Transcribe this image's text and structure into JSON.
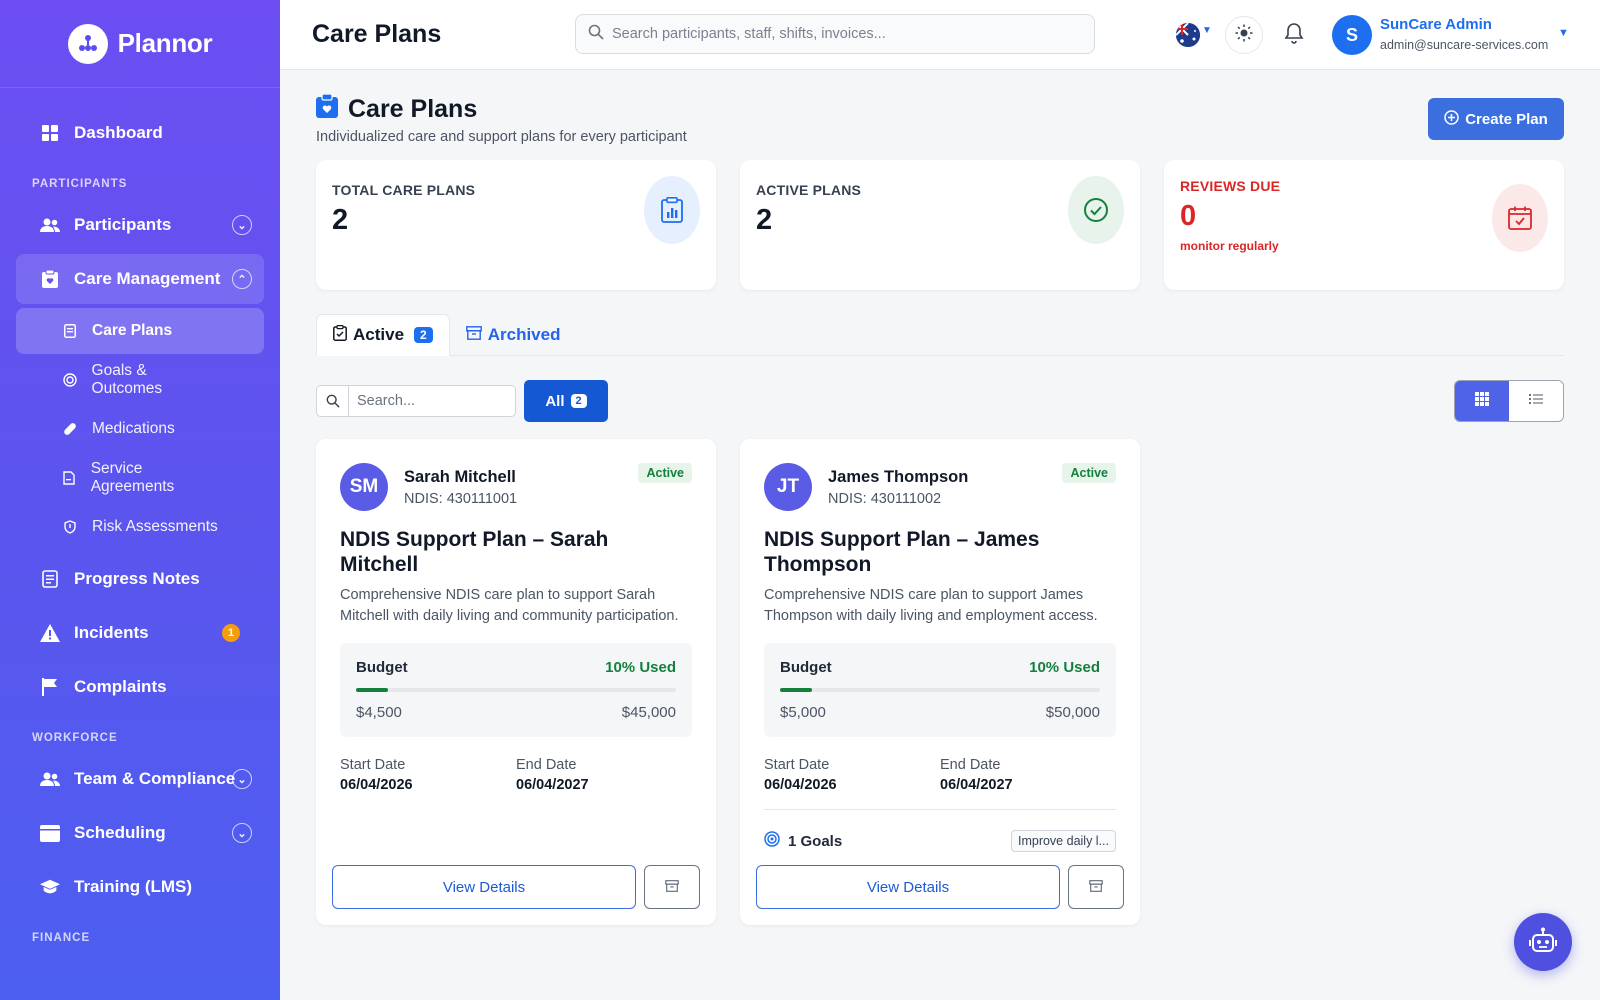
{
  "brand": {
    "name": "Plannor"
  },
  "sidebar": {
    "dashboard": "Dashboard",
    "section_participants": "PARTICIPANTS",
    "participants": "Participants",
    "care_management": "Care Management",
    "care_sub": [
      "Care Plans",
      "Goals & Outcomes",
      "Medications",
      "Service Agreements",
      "Risk Assessments"
    ],
    "progress_notes": "Progress Notes",
    "incidents": "Incidents",
    "incidents_count": "1",
    "complaints": "Complaints",
    "section_workforce": "WORKFORCE",
    "team_compliance": "Team & Compliance",
    "scheduling": "Scheduling",
    "training": "Training (LMS)",
    "section_finance": "FINANCE"
  },
  "header": {
    "title": "Care Plans",
    "search_placeholder": "Search participants, staff, shifts, invoices...",
    "user_initial": "S",
    "user_name": "SunCare Admin",
    "user_email": "admin@suncare-services.com"
  },
  "page": {
    "title": "Care Plans",
    "subtitle": "Individualized care and support plans for every participant",
    "create_label": "Create Plan"
  },
  "stats": [
    {
      "label": "TOTAL CARE PLANS",
      "value": "2"
    },
    {
      "label": "ACTIVE PLANS",
      "value": "2"
    },
    {
      "label": "REVIEWS DUE",
      "value": "0",
      "note": "monitor regularly"
    }
  ],
  "tabs": {
    "active": "Active",
    "active_count": "2",
    "archived": "Archived"
  },
  "filters": {
    "search_placeholder": "Search...",
    "all_label": "All",
    "all_count": "2"
  },
  "cards": [
    {
      "initials": "SM",
      "name": "Sarah Mitchell",
      "ndis": "NDIS: 430111001",
      "status": "Active",
      "title": "NDIS Support Plan – Sarah Mitchell",
      "desc": "Comprehensive NDIS care plan to support Sarah Mitchell with daily living and community participation.",
      "budget_label": "Budget",
      "used": "10% Used",
      "used_fraction": 0.1,
      "spent": "$4,500",
      "total": "$45,000",
      "start_label": "Start Date",
      "start": "06/04/2026",
      "end_label": "End Date",
      "end": "06/04/2027",
      "view_label": "View Details"
    },
    {
      "initials": "JT",
      "name": "James Thompson",
      "ndis": "NDIS: 430111002",
      "status": "Active",
      "title": "NDIS Support Plan – James Thompson",
      "desc": "Comprehensive NDIS care plan to support James Thompson with daily living and employment access.",
      "budget_label": "Budget",
      "used": "10% Used",
      "used_fraction": 0.1,
      "spent": "$5,000",
      "total": "$50,000",
      "start_label": "Start Date",
      "start": "06/04/2026",
      "end_label": "End Date",
      "end": "06/04/2027",
      "goals": "1 Goals",
      "goal_chip": "Improve daily l...",
      "view_label": "View Details"
    }
  ],
  "colors": {
    "accent": "#3b6fe0",
    "success": "#15803d",
    "danger": "#dc2626",
    "sidebar_top": "#6c4ef2",
    "sidebar_bottom": "#4c5ff0"
  }
}
